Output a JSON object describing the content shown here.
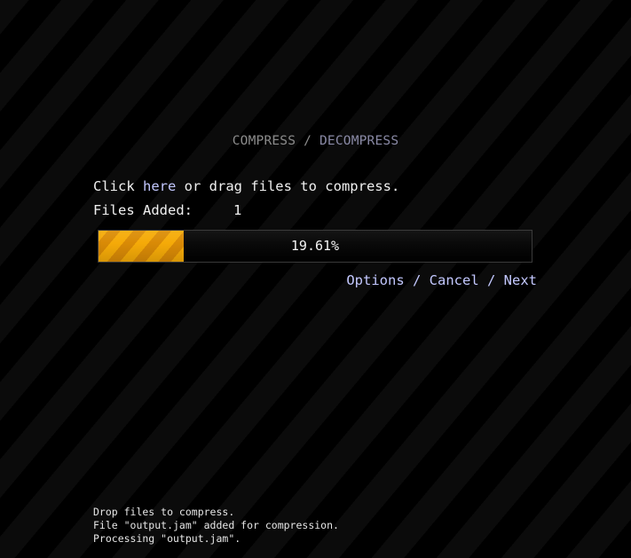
{
  "header": {
    "compress_label": "COMPRESS",
    "separator": " / ",
    "decompress_label": "DECOMPRESS",
    "colors": {
      "compress": "#8c8c8c",
      "decompress": "#8a8aa6"
    }
  },
  "instruction": {
    "prefix": "Click ",
    "link_label": "here",
    "suffix": " or drag files to compress."
  },
  "files_added": {
    "label": "Files Added:",
    "count": "1"
  },
  "progress": {
    "percent": 19.61,
    "label": "19.61%",
    "fill_color": "#f2a600",
    "stripe_color": "#d98a06"
  },
  "actions": {
    "options_label": "Options",
    "cancel_label": "Cancel",
    "next_label": "Next",
    "separator": " / ",
    "link_color": "#c3c8ff"
  },
  "log": [
    "Drop files to compress.",
    "File \"output.jam\" added for compression.",
    "Processing \"output.jam\"."
  ]
}
